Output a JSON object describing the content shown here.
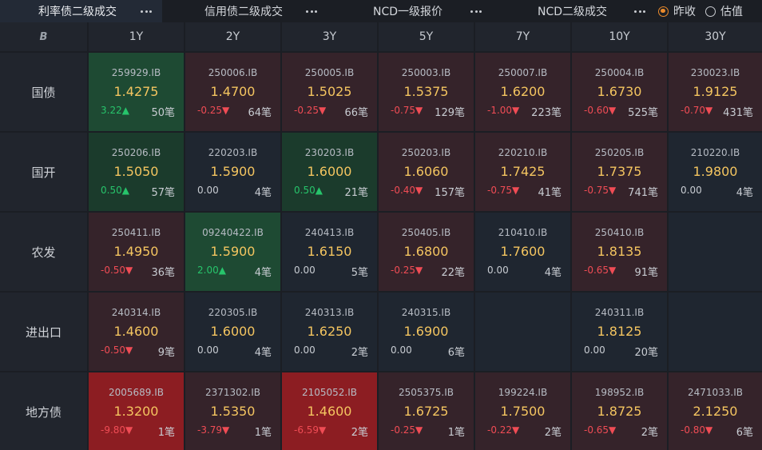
{
  "tabs": [
    {
      "label": "利率债二级成交",
      "active": true
    },
    {
      "label": "信用债二级成交",
      "active": false
    },
    {
      "label": "NCD一级报价",
      "active": false
    },
    {
      "label": "NCD二级成交",
      "active": false
    }
  ],
  "radios": [
    {
      "label": "昨收",
      "checked": true
    },
    {
      "label": "估值",
      "checked": false
    }
  ],
  "corner_logo": "B",
  "columns": [
    "1Y",
    "2Y",
    "3Y",
    "5Y",
    "7Y",
    "10Y",
    "30Y"
  ],
  "colors": {
    "up": "#27c46b",
    "down": "#f04c55",
    "yield": "#f4c560",
    "cell_green": "#1b3b2c",
    "cell_green_strong": "#1e4a33",
    "cell_red": "#35232a",
    "cell_red_strong": "#8c1d22",
    "cell_neutral": "#1f2630"
  },
  "rows": [
    {
      "label": "国债",
      "cells": [
        {
          "code": "259929.IB",
          "yield": "1.4275",
          "chg": "3.22▲",
          "dir": "up",
          "count": "50笔",
          "bg": "green_strong"
        },
        {
          "code": "250006.IB",
          "yield": "1.4700",
          "chg": "-0.25▼",
          "dir": "dn",
          "count": "64笔",
          "bg": "red"
        },
        {
          "code": "250005.IB",
          "yield": "1.5025",
          "chg": "-0.25▼",
          "dir": "dn",
          "count": "66笔",
          "bg": "red"
        },
        {
          "code": "250003.IB",
          "yield": "1.5375",
          "chg": "-0.75▼",
          "dir": "dn",
          "count": "129笔",
          "bg": "red"
        },
        {
          "code": "250007.IB",
          "yield": "1.6200",
          "chg": "-1.00▼",
          "dir": "dn",
          "count": "223笔",
          "bg": "red"
        },
        {
          "code": "250004.IB",
          "yield": "1.6730",
          "chg": "-0.60▼",
          "dir": "dn",
          "count": "525笔",
          "bg": "red"
        },
        {
          "code": "230023.IB",
          "yield": "1.9125",
          "chg": "-0.70▼",
          "dir": "dn",
          "count": "431笔",
          "bg": "red"
        }
      ]
    },
    {
      "label": "国开",
      "cells": [
        {
          "code": "250206.IB",
          "yield": "1.5050",
          "chg": "0.50▲",
          "dir": "up",
          "count": "57笔",
          "bg": "green"
        },
        {
          "code": "220203.IB",
          "yield": "1.5900",
          "chg": "0.00",
          "dir": "flat",
          "count": "4笔",
          "bg": "neutral"
        },
        {
          "code": "230203.IB",
          "yield": "1.6000",
          "chg": "0.50▲",
          "dir": "up",
          "count": "21笔",
          "bg": "green"
        },
        {
          "code": "250203.IB",
          "yield": "1.6060",
          "chg": "-0.40▼",
          "dir": "dn",
          "count": "157笔",
          "bg": "red"
        },
        {
          "code": "220210.IB",
          "yield": "1.7425",
          "chg": "-0.75▼",
          "dir": "dn",
          "count": "41笔",
          "bg": "red"
        },
        {
          "code": "250205.IB",
          "yield": "1.7375",
          "chg": "-0.75▼",
          "dir": "dn",
          "count": "741笔",
          "bg": "red"
        },
        {
          "code": "210220.IB",
          "yield": "1.9800",
          "chg": "0.00",
          "dir": "flat",
          "count": "4笔",
          "bg": "neutral"
        }
      ]
    },
    {
      "label": "农发",
      "cells": [
        {
          "code": "250411.IB",
          "yield": "1.4950",
          "chg": "-0.50▼",
          "dir": "dn",
          "count": "36笔",
          "bg": "red"
        },
        {
          "code": "09240422.IB",
          "yield": "1.5900",
          "chg": "2.00▲",
          "dir": "up",
          "count": "4笔",
          "bg": "green_strong"
        },
        {
          "code": "240413.IB",
          "yield": "1.6150",
          "chg": "0.00",
          "dir": "flat",
          "count": "5笔",
          "bg": "neutral"
        },
        {
          "code": "250405.IB",
          "yield": "1.6800",
          "chg": "-0.25▼",
          "dir": "dn",
          "count": "22笔",
          "bg": "red"
        },
        {
          "code": "210410.IB",
          "yield": "1.7600",
          "chg": "0.00",
          "dir": "flat",
          "count": "4笔",
          "bg": "neutral"
        },
        {
          "code": "250410.IB",
          "yield": "1.8135",
          "chg": "-0.65▼",
          "dir": "dn",
          "count": "91笔",
          "bg": "red"
        },
        null
      ]
    },
    {
      "label": "进出口",
      "cells": [
        {
          "code": "240314.IB",
          "yield": "1.4600",
          "chg": "-0.50▼",
          "dir": "dn",
          "count": "9笔",
          "bg": "red"
        },
        {
          "code": "220305.IB",
          "yield": "1.6000",
          "chg": "0.00",
          "dir": "flat",
          "count": "4笔",
          "bg": "neutral"
        },
        {
          "code": "240313.IB",
          "yield": "1.6250",
          "chg": "0.00",
          "dir": "flat",
          "count": "2笔",
          "bg": "neutral"
        },
        {
          "code": "240315.IB",
          "yield": "1.6900",
          "chg": "0.00",
          "dir": "flat",
          "count": "6笔",
          "bg": "neutral"
        },
        null,
        {
          "code": "240311.IB",
          "yield": "1.8125",
          "chg": "0.00",
          "dir": "flat",
          "count": "20笔",
          "bg": "neutral"
        },
        null
      ]
    },
    {
      "label": "地方债",
      "cells": [
        {
          "code": "2005689.IB",
          "yield": "1.3200",
          "chg": "-9.80▼",
          "dir": "dn",
          "count": "1笔",
          "bg": "red_strong"
        },
        {
          "code": "2371302.IB",
          "yield": "1.5350",
          "chg": "-3.79▼",
          "dir": "dn",
          "count": "1笔",
          "bg": "red"
        },
        {
          "code": "2105052.IB",
          "yield": "1.4600",
          "chg": "-6.59▼",
          "dir": "dn",
          "count": "2笔",
          "bg": "red_strong"
        },
        {
          "code": "2505375.IB",
          "yield": "1.6725",
          "chg": "-0.25▼",
          "dir": "dn",
          "count": "1笔",
          "bg": "red"
        },
        {
          "code": "199224.IB",
          "yield": "1.7500",
          "chg": "-0.22▼",
          "dir": "dn",
          "count": "2笔",
          "bg": "red"
        },
        {
          "code": "198952.IB",
          "yield": "1.8725",
          "chg": "-0.65▼",
          "dir": "dn",
          "count": "2笔",
          "bg": "red"
        },
        {
          "code": "2471033.IB",
          "yield": "2.1250",
          "chg": "-0.80▼",
          "dir": "dn",
          "count": "6笔",
          "bg": "red"
        }
      ]
    }
  ]
}
